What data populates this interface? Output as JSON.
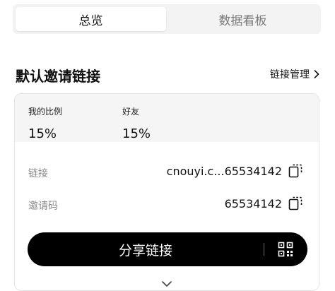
{
  "tabs": [
    {
      "label": "总览",
      "active": true
    },
    {
      "label": "数据看板",
      "active": false
    }
  ],
  "section": {
    "title": "默认邀请链接",
    "manage_label": "链接管理"
  },
  "stats": [
    {
      "label": "我的比例",
      "value": "15%"
    },
    {
      "label": "好友",
      "value": "15%"
    }
  ],
  "link_row": {
    "label": "链接",
    "value": "cnouyi.c...65534142"
  },
  "code_row": {
    "label": "邀请码",
    "value": "65534142"
  },
  "share_button": {
    "label": "分享链接"
  },
  "icons": {
    "copy": "copy-icon",
    "qr": "qr-code-icon",
    "expand": "chevron-down-icon",
    "manage": "chevron-right-icon"
  },
  "colors": {
    "button_bg": "#000000",
    "stats_bg": "#f5f5f5",
    "segment_bg": "#f3f3f3"
  }
}
